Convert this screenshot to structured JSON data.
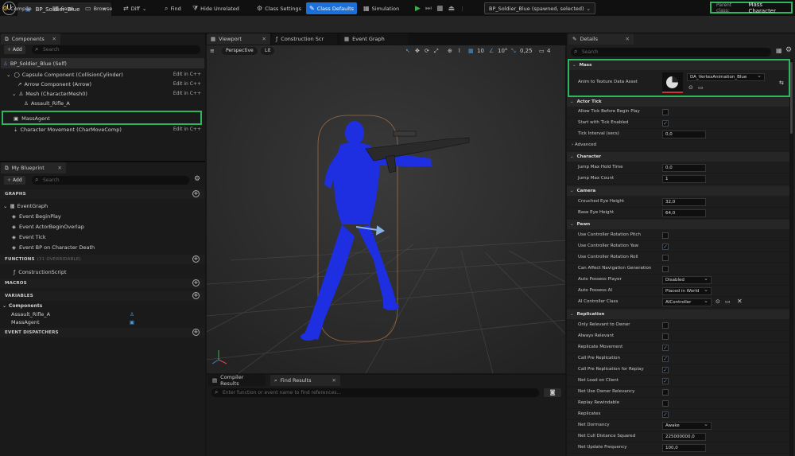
{
  "titlebar": {
    "asset_tab": "BP_Soldier_Blue",
    "parent_class_label": "Parent class:",
    "parent_class_value": "Mass Character"
  },
  "toolbar": {
    "compile": "Compile",
    "save": "Save",
    "browse": "Browse",
    "diff": "Diff",
    "find": "Find",
    "hide_unrelated": "Hide Unrelated",
    "class_settings": "Class Settings",
    "class_defaults": "Class Defaults",
    "simulation": "Simulation",
    "debug_object": "BP_Soldier_Blue (spawned, selected)"
  },
  "components": {
    "tab": "Components",
    "add": "Add",
    "search_placeholder": "Search",
    "items": [
      {
        "label": "BP_Soldier_Blue (Self)",
        "edit": ""
      },
      {
        "label": "Capsule Component (CollisionCylinder)",
        "edit": "Edit in C++"
      },
      {
        "label": "Arrow Component (Arrow)",
        "edit": "Edit in C++"
      },
      {
        "label": "Mesh (CharacterMesh0)",
        "edit": "Edit in C++"
      },
      {
        "label": "Assault_Rifle_A",
        "edit": ""
      },
      {
        "label": "MassAgent",
        "edit": ""
      },
      {
        "label": "Character Movement (CharMoveComp)",
        "edit": "Edit in C++"
      }
    ]
  },
  "my_blueprint": {
    "tab": "My Blueprint",
    "add": "Add",
    "search_placeholder": "Search",
    "graphs": "GRAPHS",
    "event_graph": "EventGraph",
    "events": [
      "Event BeginPlay",
      "Event ActorBeginOverlap",
      "Event Tick",
      "Event BP on Character Death"
    ],
    "functions": "FUNCTIONS",
    "functions_note": "(31 OVERRIDABLE)",
    "construction_script": "ConstructionScript",
    "macros": "MACROS",
    "variables": "VARIABLES",
    "components_header": "Components",
    "variable_items": [
      "Assault_Rifle_A",
      "MassAgent"
    ],
    "event_dispatchers": "EVENT DISPATCHERS"
  },
  "editor_tabs": [
    "Viewport",
    "Construction Scr",
    "Event Graph"
  ],
  "viewport": {
    "perspective": "Perspective",
    "lit": "Lit",
    "grid": "10",
    "angle": "10°",
    "scale": "0,25",
    "cam": "4"
  },
  "bottom": {
    "compiler_results": "Compiler Results",
    "find_results": "Find Results",
    "find_placeholder": "Enter function or event name to find references..."
  },
  "details": {
    "tab": "Details",
    "search_placeholder": "Search",
    "mass_section": "Mass",
    "anim_label": "Anim to Texture Data Asset",
    "anim_value": "DA_VertexAnimation_Blue",
    "actor_tick": "Actor Tick",
    "actor_tick_rows": [
      {
        "label": "Allow Tick Before Begin Play",
        "type": "chk",
        "value": ""
      },
      {
        "label": "Start with Tick Enabled",
        "type": "chk",
        "value": "✓"
      },
      {
        "label": "Tick Interval (secs)",
        "type": "val",
        "value": "0,0"
      }
    ],
    "advanced": "Advanced",
    "character": "Character",
    "character_rows": [
      {
        "label": "Jump Max Hold Time",
        "type": "val",
        "value": "0,0"
      },
      {
        "label": "Jump Max Count",
        "type": "val",
        "value": "1"
      }
    ],
    "camera": "Camera",
    "camera_rows": [
      {
        "label": "Crouched Eye Height",
        "type": "val",
        "value": "32,0"
      },
      {
        "label": "Base Eye Height",
        "type": "val",
        "value": "64,0"
      }
    ],
    "pawn": "Pawn",
    "pawn_rows": [
      {
        "label": "Use Controller Rotation Pitch",
        "type": "chk",
        "value": ""
      },
      {
        "label": "Use Controller Rotation Yaw",
        "type": "chk",
        "value": "✓"
      },
      {
        "label": "Use Controller Rotation Roll",
        "type": "chk",
        "value": ""
      },
      {
        "label": "Can Affect Navigation Generation",
        "type": "chk",
        "value": ""
      },
      {
        "label": "Auto Possess Player",
        "type": "dd",
        "value": "Disabled"
      },
      {
        "label": "Auto Possess AI",
        "type": "dd",
        "value": "Placed in World"
      },
      {
        "label": "AI Controller Class",
        "type": "dd",
        "value": "AIController"
      }
    ],
    "replication": "Replication",
    "replication_rows": [
      {
        "label": "Only Relevant to Owner",
        "type": "chk",
        "value": ""
      },
      {
        "label": "Always Relevant",
        "type": "chk",
        "value": ""
      },
      {
        "label": "Replicate Movement",
        "type": "chk",
        "value": "✓"
      },
      {
        "label": "Call Pre Replication",
        "type": "chk",
        "value": "✓"
      },
      {
        "label": "Call Pre Replication for Replay",
        "type": "chk",
        "value": "✓"
      },
      {
        "label": "Net Load on Client",
        "type": "chk",
        "value": "✓"
      },
      {
        "label": "Net Use Owner Relevancy",
        "type": "chk",
        "value": ""
      },
      {
        "label": "Replay Rewindable",
        "type": "chk",
        "value": ""
      },
      {
        "label": "Replicates",
        "type": "chk",
        "value": "✓"
      },
      {
        "label": "Net Dormancy",
        "type": "dd",
        "value": "Awake"
      },
      {
        "label": "Net Cull Distance Squared",
        "type": "val",
        "value": "225000000,0"
      },
      {
        "label": "Net Update Frequency",
        "type": "val",
        "value": "100,0"
      }
    ]
  },
  "colors": {
    "accent": "#1a6fd8",
    "highlight": "#2fb55d",
    "play": "#3ab04a"
  }
}
